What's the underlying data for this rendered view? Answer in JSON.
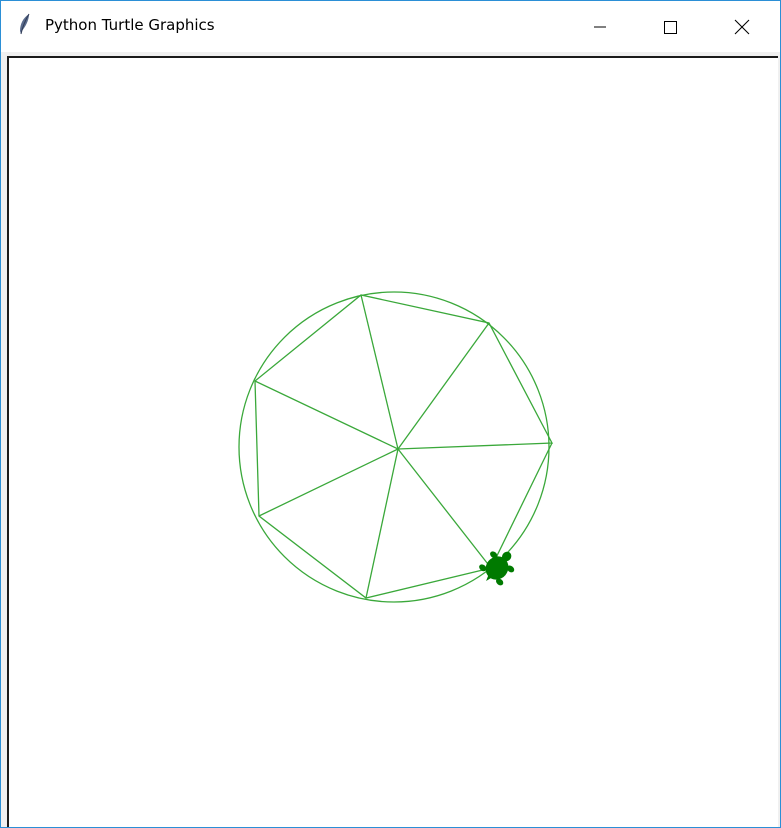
{
  "window": {
    "title": "Python Turtle Graphics",
    "app_icon": "feather-icon",
    "buttons": {
      "minimize_icon": "minimize-icon",
      "maximize_icon": "maximize-icon",
      "close_icon": "close-icon"
    }
  },
  "canvas": {
    "background": "#ffffff",
    "pen_color": "#3aa83a",
    "turtle_color": "#007a00",
    "turtle_icon": "turtle-icon"
  }
}
